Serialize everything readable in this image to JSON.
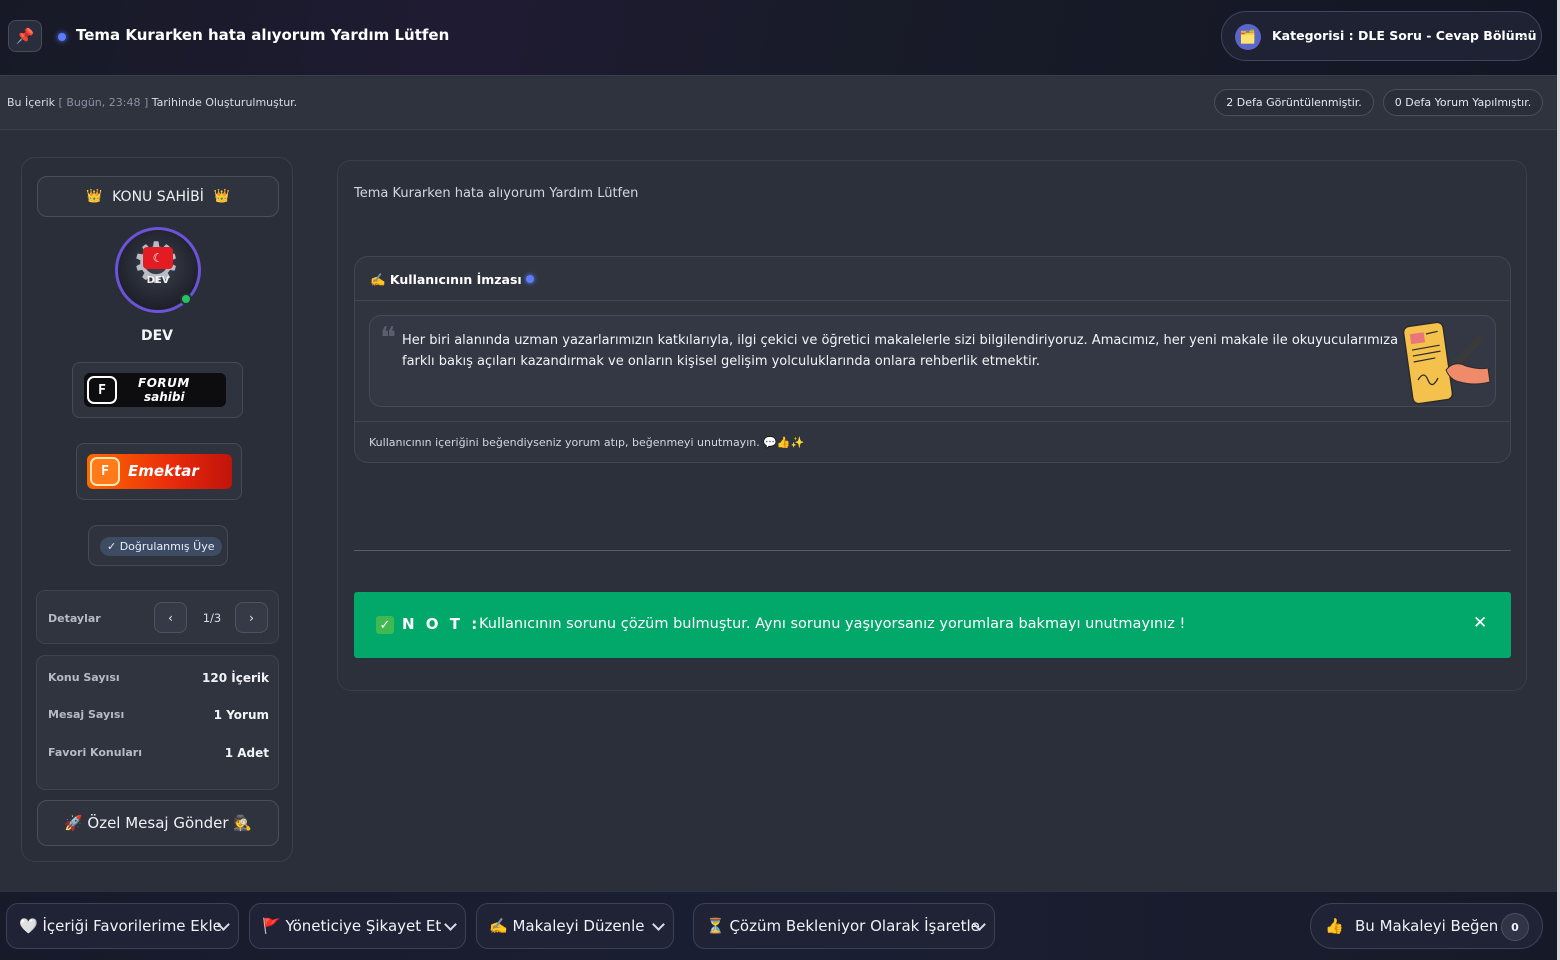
{
  "header": {
    "pin_icon": "📌",
    "title": "Tema Kurarken hata alıyorum Yardım Lütfen",
    "category_icon": "🗂️",
    "category": "Kategorisi : DLE Soru - Cevap Bölümü"
  },
  "meta": {
    "prefix": "Bu İçerik",
    "timestamp": "[ Bugün, 23:48 ]",
    "suffix": "Tarihinde Oluşturulmuştur.",
    "views": "2 Defa Görüntülenmiştir.",
    "comments": "0 Defa Yorum Yapılmıştır."
  },
  "profile": {
    "owner_label": "KONU SAHİBİ",
    "crown_icon": "👑",
    "avatar_text": "DEV",
    "username": "DEV",
    "badge_forum_line1": "FORUM",
    "badge_forum_line2": "sahibi",
    "badge_emektar": "Emektar",
    "verified": "✓ Doğrulanmış Üye",
    "details_label": "Detaylar",
    "pager": "1/3",
    "prev": "‹",
    "next": "›",
    "stats": [
      {
        "label": "Konu Sayısı",
        "value": "120 İçerik"
      },
      {
        "label": "Mesaj Sayısı",
        "value": "1 Yorum"
      },
      {
        "label": "Favori Konuları",
        "value": "1 Adet"
      }
    ],
    "pm_label": "🚀 Özel Mesaj Gönder 🕵️"
  },
  "content": {
    "body": "Tema Kurarken hata alıyorum Yardım Lütfen",
    "signature_title": "✍️ Kullanıcının İmzası",
    "signature_text": "Her biri alanında uzman yazarlarımızın katkılarıyla, ilgi çekici ve öğretici makalelerle sizi bilgilendiriyoruz. Amacımız, her yeni makale ile okuyucularımıza farklı bakış açıları kazandırmak ve onların kişisel gelişim yolculuklarında onlara rehberlik etmektir.",
    "signature_footer": "Kullanıcının içeriğini beğendiyseniz yorum atıp, beğenmeyi unutmayın. 💬👍✨",
    "note_label": "N O T :",
    "note_text": "Kullanıcının sorunu çözüm bulmuştur. Aynı sorunu yaşıyorsanız yorumlara bakmayı unutmayınız !",
    "note_close": "✕"
  },
  "actions": {
    "favorite": "🤍 İçeriği Favorilerime Ekle",
    "report": "🚩 Yöneticiye Şikayet Et",
    "edit": "✍️ Makaleyi Düzenle",
    "solution": "⏳ Çözüm Bekleniyor Olarak İşaretle",
    "like_icon": "👍",
    "like": "Bu Makaleyi Beğen",
    "like_count": "0"
  },
  "colors": {
    "accent": "#5b7cff",
    "note_bg": "#02a86a",
    "avatar_ring": "#6c53d8"
  }
}
